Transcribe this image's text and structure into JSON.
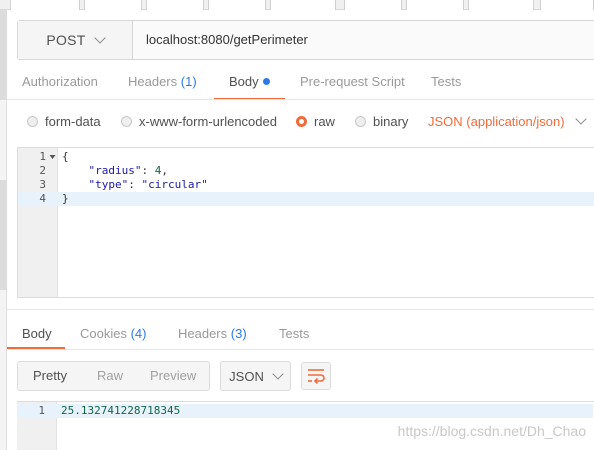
{
  "request": {
    "method": "POST",
    "url": "localhost:8080/getPerimeter"
  },
  "request_tabs": {
    "authorization": "Authorization",
    "headers": "Headers",
    "headers_count": "(1)",
    "body": "Body",
    "pre_request": "Pre-request Script",
    "tests": "Tests"
  },
  "body_options": {
    "form_data": "form-data",
    "urlencoded": "x-www-form-urlencoded",
    "raw": "raw",
    "binary": "binary",
    "selected": "raw",
    "content_type": "JSON (application/json)"
  },
  "request_body": {
    "lines": [
      {
        "num": "1",
        "text": "{"
      },
      {
        "num": "2",
        "key": "\"radius\"",
        "sep": ": ",
        "value": "4",
        "trail": ","
      },
      {
        "num": "3",
        "key": "\"type\"",
        "sep": ": ",
        "value": "\"circular\"",
        "trail": ""
      },
      {
        "num": "4",
        "text": "}"
      }
    ]
  },
  "response_tabs": {
    "body": "Body",
    "cookies": "Cookies",
    "cookies_count": "(4)",
    "headers": "Headers",
    "headers_count": "(3)",
    "tests": "Tests"
  },
  "response_view": {
    "pretty": "Pretty",
    "raw": "Raw",
    "preview": "Preview",
    "format": "JSON"
  },
  "response_body": {
    "line_num": "1",
    "text": "25.132741228718345"
  },
  "watermark": "https://blog.csdn.net/Dh_Chao",
  "colors": {
    "accent": "#f26b3a",
    "count_blue": "#2c7be5"
  },
  "icons": {
    "method_dropdown": "chevron-down-icon",
    "content_type_dropdown": "chevron-down-icon",
    "format_dropdown": "chevron-down-icon",
    "wrap": "wrap-lines-icon",
    "fold": "fold-arrow-icon"
  }
}
